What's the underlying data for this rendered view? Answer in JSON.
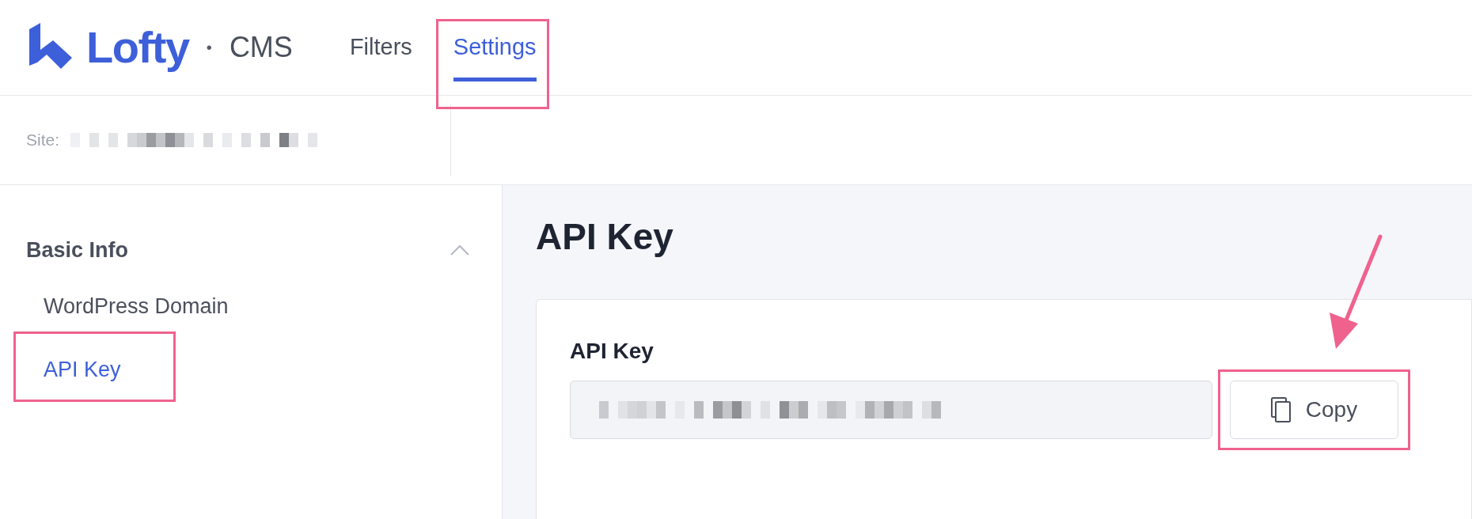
{
  "header": {
    "logo": "Lofty",
    "separator": "•",
    "product": "CMS",
    "tabs": [
      {
        "label": "Filters",
        "selected": false,
        "highlighted": false
      },
      {
        "label": "Settings",
        "selected": true,
        "highlighted": true
      }
    ]
  },
  "site_bar": {
    "label": "Site:"
  },
  "sidebar": {
    "section": {
      "title": "Basic Info",
      "expanded": true,
      "items": [
        {
          "label": "WordPress Domain",
          "selected": false,
          "highlighted": false
        },
        {
          "label": "API Key",
          "selected": true,
          "highlighted": true
        }
      ]
    }
  },
  "main": {
    "title": "API Key",
    "card": {
      "label": "API Key",
      "copy_button": {
        "label": "Copy",
        "highlighted": true,
        "arrow": true
      }
    }
  }
}
